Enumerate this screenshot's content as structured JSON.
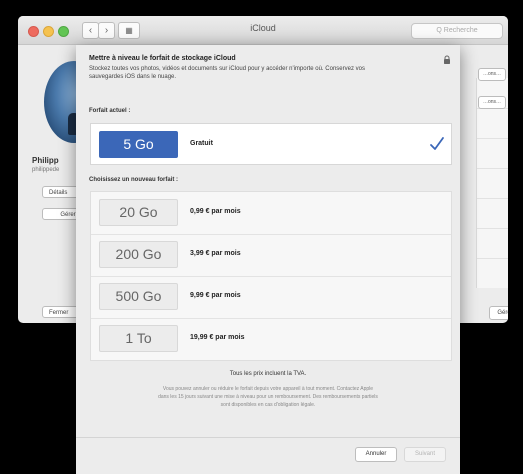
{
  "window": {
    "title": "iCloud",
    "nav_back": "‹",
    "nav_forward": "›",
    "nav_grid": "▦",
    "search_placeholder": "Q Recherche"
  },
  "sidebar": {
    "user_name": "Philipp",
    "user_id": "philippede",
    "details_label": "Détails",
    "manage_label": "Gérer",
    "close_label": "Fermer"
  },
  "right_panel": {
    "button_1": "…ons…",
    "button_2": "…ons…",
    "manage_label": "Gérer"
  },
  "sheet": {
    "title": "Mettre à niveau le forfait de stockage iCloud",
    "description": "Stockez toutes vos photos, vidéos et documents sur iCloud pour y accéder n'importe où. Conservez vos sauvegardes iOS dans le nuage.",
    "current_label": "Forfait actuel :",
    "current_plan": {
      "size": "5 Go",
      "price": "Gratuit",
      "selected": true
    },
    "new_label": "Choisissez un nouveau forfait :",
    "plans": [
      {
        "size": "20 Go",
        "price": "0,99 € par mois"
      },
      {
        "size": "200 Go",
        "price": "3,99 € par mois"
      },
      {
        "size": "500 Go",
        "price": "9,99 € par mois"
      },
      {
        "size": "1 To",
        "price": "19,99 € par mois"
      }
    ],
    "tax_note": "Tous les prix incluent la TVA.",
    "fine_print": "Vous pouvez annuler ou réduire le forfait depuis votre appareil à tout moment. Contactez Apple dans les 15 jours suivant une mise à niveau pour un remboursement. Des remboursements partiels sont disponibles en cas d'obligation légale.",
    "cancel_label": "Annuler",
    "next_label": "Suivant"
  },
  "colors": {
    "accent": "#3b67b8",
    "check": "#3b67b8"
  }
}
